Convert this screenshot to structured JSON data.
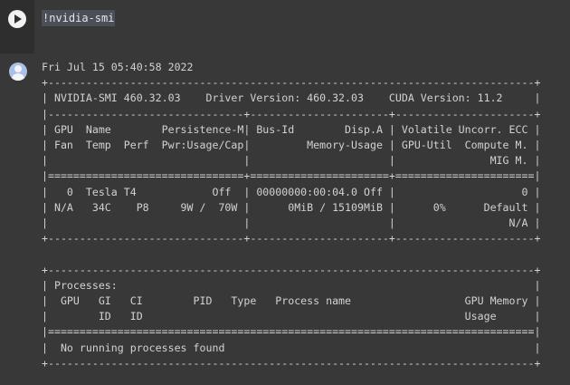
{
  "cell": {
    "code": "!nvidia-smi"
  },
  "output": {
    "lines": [
      "Fri Jul 15 05:40:58 2022",
      "+-----------------------------------------------------------------------------+",
      "| NVIDIA-SMI 460.32.03    Driver Version: 460.32.03    CUDA Version: 11.2     |",
      "|-------------------------------+----------------------+----------------------+",
      "| GPU  Name        Persistence-M| Bus-Id        Disp.A | Volatile Uncorr. ECC |",
      "| Fan  Temp  Perf  Pwr:Usage/Cap|         Memory-Usage | GPU-Util  Compute M. |",
      "|                               |                      |               MIG M. |",
      "|===============================+======================+======================|",
      "|   0  Tesla T4            Off  | 00000000:00:04.0 Off |                    0 |",
      "| N/A   34C    P8     9W /  70W |      0MiB / 15109MiB |      0%      Default |",
      "|                               |                      |                  N/A |",
      "+-------------------------------+----------------------+----------------------+",
      "",
      "+-----------------------------------------------------------------------------+",
      "| Processes:                                                                  |",
      "|  GPU   GI   CI        PID   Type   Process name                  GPU Memory |",
      "|        ID   ID                                                   Usage      |",
      "|=============================================================================|",
      "|  No running processes found                                                 |",
      "+-----------------------------------------------------------------------------+"
    ]
  },
  "icons": {
    "run": "play-circle-icon",
    "avatar": "user-avatar-icon"
  }
}
